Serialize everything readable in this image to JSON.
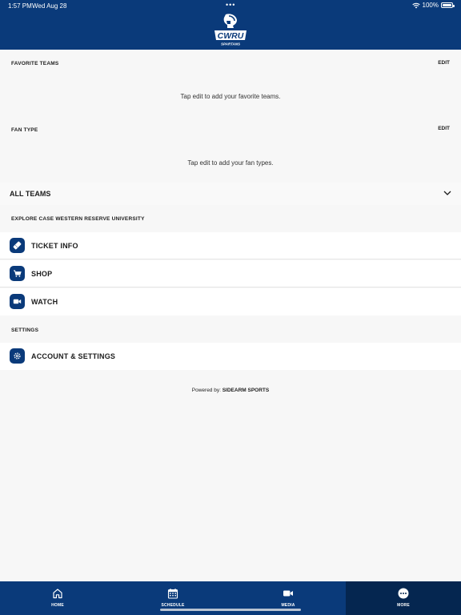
{
  "status_bar": {
    "time": "1:57 PM",
    "date": "Wed Aug 28",
    "dots": "•••",
    "battery": "100%",
    "battery_level": 1.0
  },
  "header": {
    "logo_icon": "cwru-spartan-logo-icon",
    "logo_text": "CWRU",
    "logo_subtext": "SPARTANS"
  },
  "favorite_teams": {
    "heading": "FAVORITE TEAMS",
    "edit_label": "EDIT",
    "empty_message": "Tap edit to add your favorite teams."
  },
  "fan_type": {
    "heading": "FAN TYPE",
    "edit_label": "EDIT",
    "empty_message": "Tap edit to add your fan types."
  },
  "all_teams": {
    "label": "ALL TEAMS",
    "icon": "chevron-down-icon"
  },
  "explore": {
    "heading": "EXPLORE CASE WESTERN RESERVE UNIVERSITY",
    "items": [
      {
        "label": "TICKET INFO",
        "icon": "ticket-icon"
      },
      {
        "label": "SHOP",
        "icon": "cart-icon"
      },
      {
        "label": "WATCH",
        "icon": "video-camera-icon"
      }
    ]
  },
  "settings": {
    "heading": "SETTINGS",
    "items": [
      {
        "label": "ACCOUNT & SETTINGS",
        "icon": "gear-icon"
      }
    ]
  },
  "footer": {
    "powered_prefix": "Powered by:",
    "powered_brand": "SIDEARM SPORTS"
  },
  "tabbar": {
    "tabs": [
      {
        "label": "HOME",
        "icon": "home-icon"
      },
      {
        "label": "SCHEDULE",
        "icon": "calendar-icon"
      },
      {
        "label": "MEDIA",
        "icon": "video-camera-icon"
      },
      {
        "label": "MORE",
        "icon": "more-icon"
      }
    ],
    "active_index": 3
  },
  "colors": {
    "brand": "#0a3a7a",
    "brand_dark": "#052650",
    "background": "#f7f7f7"
  }
}
